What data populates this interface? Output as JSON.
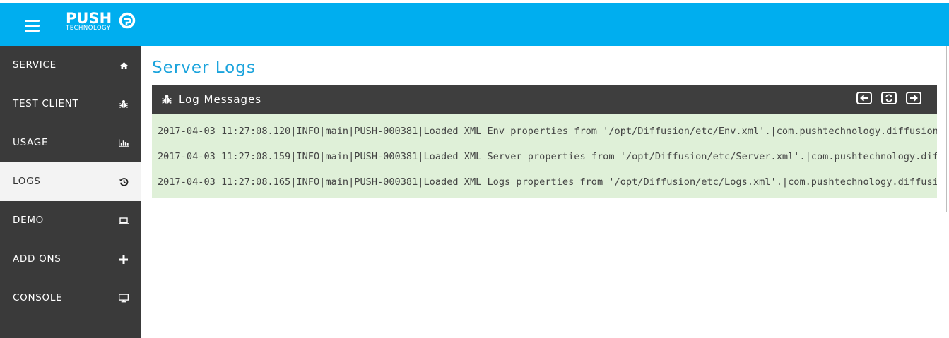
{
  "brand": {
    "name": "PUSH",
    "subtitle": "TECHNOLOGY",
    "accent": "#00aeef"
  },
  "sidebar": {
    "items": [
      {
        "label": "SERVICE",
        "icon": "home-icon"
      },
      {
        "label": "TEST CLIENT",
        "icon": "bug-icon"
      },
      {
        "label": "USAGE",
        "icon": "bar-chart-icon"
      },
      {
        "label": "LOGS",
        "icon": "history-icon",
        "active": true
      },
      {
        "label": "DEMO",
        "icon": "laptop-icon"
      },
      {
        "label": "ADD ONS",
        "icon": "plus-icon"
      },
      {
        "label": "CONSOLE",
        "icon": "desktop-icon"
      }
    ]
  },
  "main": {
    "title": "Server Logs",
    "panel": {
      "title": "Log Messages",
      "controls": [
        "previous-icon",
        "refresh-icon",
        "next-icon"
      ],
      "rows": [
        "2017-04-03 11:27:08.120|INFO|main|PUSH-000381|Loaded XML Env properties from '/opt/Diffusion/etc/Env.xml'.|com.pushtechnology.diffusion",
        "2017-04-03 11:27:08.159|INFO|main|PUSH-000381|Loaded XML Server properties from '/opt/Diffusion/etc/Server.xml'.|com.pushtechnology.diffusion",
        "2017-04-03 11:27:08.165|INFO|main|PUSH-000381|Loaded XML Logs properties from '/opt/Diffusion/etc/Logs.xml'.|com.pushtechnology.diffusion"
      ]
    }
  }
}
